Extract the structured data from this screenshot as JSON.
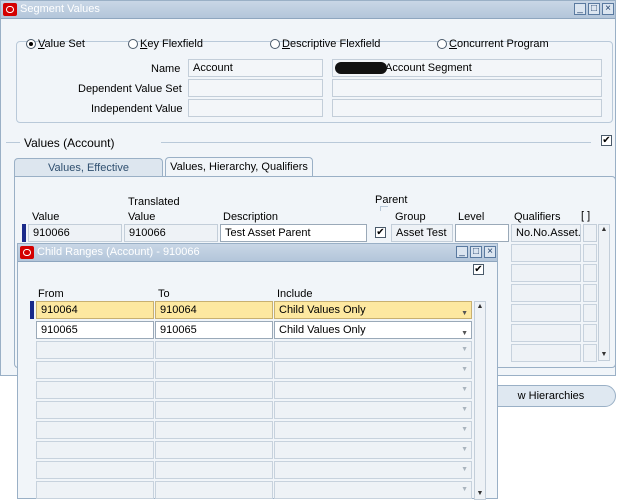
{
  "main_window": {
    "title": "Segment Values",
    "radio_options": [
      "Value Set",
      "Key Flexfield",
      "Descriptive Flexfield",
      "Concurrent Program"
    ],
    "radio_hotkeys": [
      "V",
      "K",
      "D",
      "C"
    ],
    "selected_radio": "Value Set",
    "name_label": "Name",
    "name_value": "Account",
    "name_desc": "Account Segment",
    "dependent_label": "Dependent Value Set",
    "independent_label": "Independent Value",
    "section_title": "Values (Account)",
    "tabs": [
      "Values, Effective",
      "Values, Hierarchy, Qualifiers"
    ],
    "active_tab": "Values, Hierarchy, Qualifiers",
    "columns": {
      "value": "Value",
      "translated_top": "Translated",
      "translated_bottom": "Value",
      "description": "Description",
      "parent": "Parent",
      "group": "Group",
      "level": "Level",
      "qualifiers": "Qualifiers",
      "brackets": "[ ]"
    },
    "row": {
      "value": "910066",
      "translated": "910066",
      "description": "Test Asset Parent",
      "parent_checked": true,
      "group": "Asset Test",
      "level": "",
      "qualifiers": "No.No.Asset.N"
    },
    "button_partial": "w Hierarchies"
  },
  "child_window": {
    "title": "Child Ranges (Account) - 910066",
    "columns": {
      "from": "From",
      "to": "To",
      "include": "Include"
    },
    "rows": [
      {
        "from": "910064",
        "to": "910064",
        "include": "Child Values Only"
      },
      {
        "from": "910065",
        "to": "910065",
        "include": "Child Values Only"
      }
    ]
  },
  "colors": {
    "titlebar": "#b3c6da",
    "window_bg": "#f1f5f9",
    "current_row": "#fde8a0",
    "brand_red": "#d40000"
  }
}
